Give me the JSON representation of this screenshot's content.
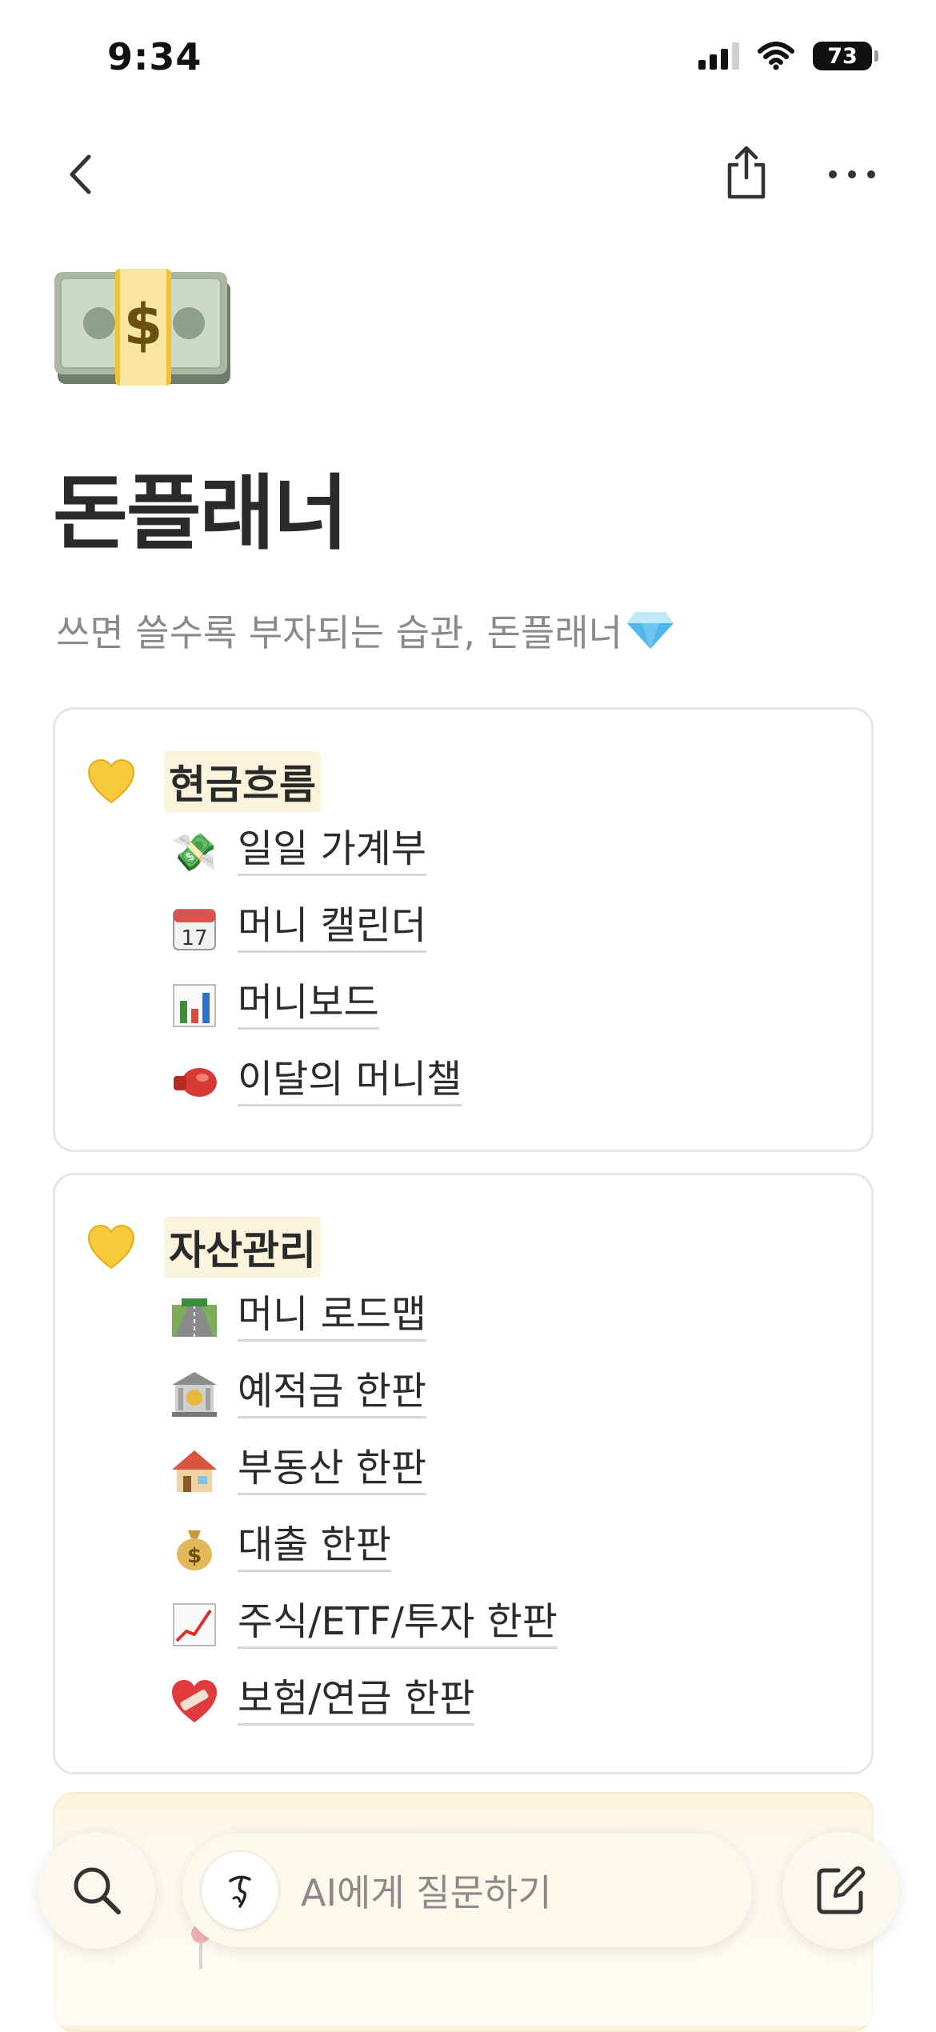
{
  "status_bar": {
    "time": "9:34",
    "battery": "73"
  },
  "page": {
    "title": "돈플래너",
    "subtitle": "쓰면 쓸수록 부자되는 습관, 돈플래너"
  },
  "sections": [
    {
      "icon": "yellow-heart-icon",
      "title": "현금흐름",
      "links": [
        {
          "icon": "money-with-wings-icon",
          "label": "일일 가계부"
        },
        {
          "icon": "calendar-icon",
          "label": "머니 캘린더"
        },
        {
          "icon": "bar-chart-icon",
          "label": "머니보드"
        },
        {
          "icon": "boxing-glove-icon",
          "label": "이달의 머니챌"
        }
      ]
    },
    {
      "icon": "yellow-heart-icon",
      "title": "자산관리",
      "links": [
        {
          "icon": "railway-track-icon",
          "label": "머니 로드맵"
        },
        {
          "icon": "bank-icon",
          "label": "예적금 한판"
        },
        {
          "icon": "house-icon",
          "label": "부동산 한판"
        },
        {
          "icon": "money-bag-icon",
          "label": "대출 한판"
        },
        {
          "icon": "chart-increasing-icon",
          "label": "주식/ETF/투자 한판"
        },
        {
          "icon": "mending-heart-icon",
          "label": "보험/연금 한판"
        }
      ]
    }
  ],
  "bottom_bar": {
    "ask_placeholder": "AI에게 질문하기"
  },
  "colors": {
    "highlight": "#fbf3db",
    "card_border": "#e6e6e6",
    "bar_bg": "#fcf8ec"
  }
}
